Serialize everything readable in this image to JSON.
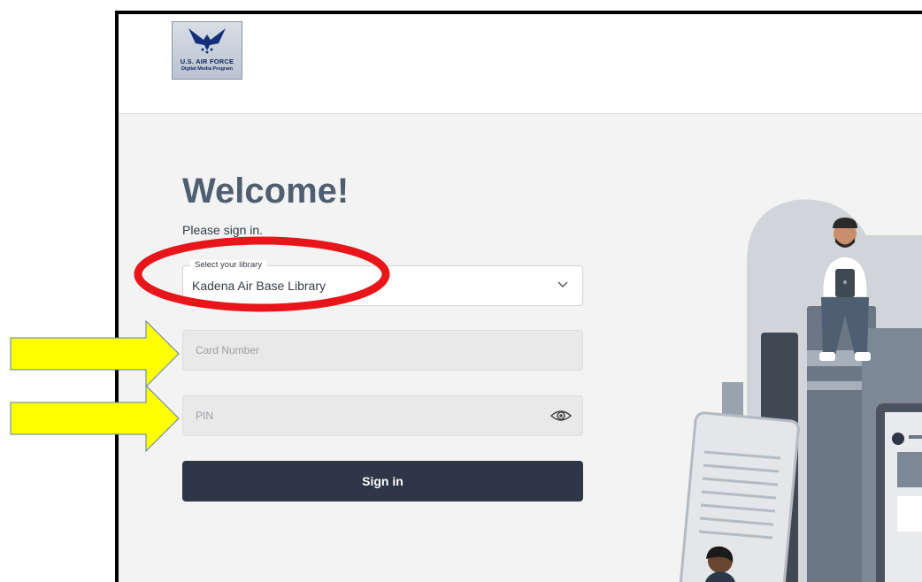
{
  "logo": {
    "line1": "U.S. AIR FORCE",
    "line2": "Digital Media Program"
  },
  "login": {
    "title": "Welcome!",
    "subtitle": "Please sign in.",
    "library_label": "Select your library",
    "library_value": "Kadena Air Base Library",
    "card_placeholder": "Card Number",
    "pin_placeholder": "PIN",
    "signin_label": "Sign in"
  },
  "colors": {
    "title": "#4f5f71",
    "button": "#2d3748",
    "field_bg": "#e9e9e9",
    "annotation_circle": "#e8161b",
    "annotation_arrow": "#ffff00"
  },
  "icons": [
    "air-force-logo",
    "chevron-down-icon",
    "eye-icon"
  ]
}
